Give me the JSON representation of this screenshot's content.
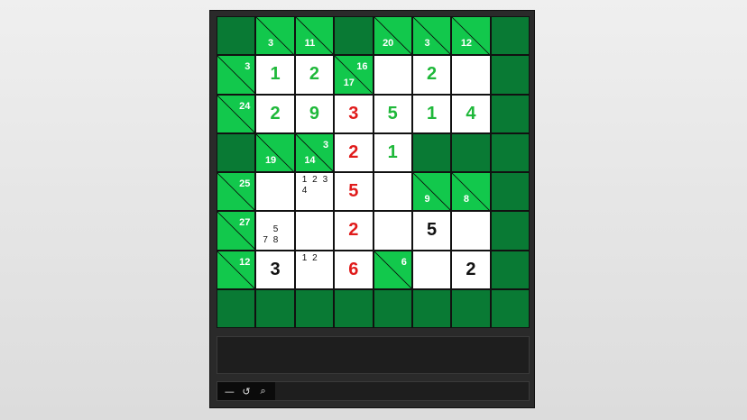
{
  "colors": {
    "clue": "#12c84c",
    "block": "#097a34",
    "given": "#1fb83a",
    "error": "#e01b1b",
    "entry": "#111111"
  },
  "rows": [
    [
      {
        "t": "block"
      },
      {
        "t": "clue",
        "down": "3"
      },
      {
        "t": "clue",
        "down": "11"
      },
      {
        "t": "block"
      },
      {
        "t": "clue",
        "down": "20"
      },
      {
        "t": "clue",
        "down": "3"
      },
      {
        "t": "clue",
        "down": "12"
      },
      {
        "t": "block"
      }
    ],
    [
      {
        "t": "clue",
        "across": "3"
      },
      {
        "t": "white",
        "v": "1",
        "s": "given"
      },
      {
        "t": "white",
        "v": "2",
        "s": "given"
      },
      {
        "t": "clue",
        "down": "17",
        "across": "16"
      },
      {
        "t": "white"
      },
      {
        "t": "white",
        "v": "2",
        "s": "given"
      },
      {
        "t": "white"
      },
      {
        "t": "block"
      }
    ],
    [
      {
        "t": "clue",
        "across": "24"
      },
      {
        "t": "white",
        "v": "2",
        "s": "given"
      },
      {
        "t": "white",
        "v": "9",
        "s": "given"
      },
      {
        "t": "white",
        "v": "3",
        "s": "error"
      },
      {
        "t": "white",
        "v": "5",
        "s": "given"
      },
      {
        "t": "white",
        "v": "1",
        "s": "given"
      },
      {
        "t": "white",
        "v": "4",
        "s": "given"
      },
      {
        "t": "block"
      }
    ],
    [
      {
        "t": "block"
      },
      {
        "t": "clue",
        "down": "19"
      },
      {
        "t": "clue",
        "down": "14",
        "across": "3"
      },
      {
        "t": "white",
        "v": "2",
        "s": "error"
      },
      {
        "t": "white",
        "v": "1",
        "s": "given"
      },
      {
        "t": "block"
      },
      {
        "t": "block"
      },
      {
        "t": "block"
      }
    ],
    [
      {
        "t": "clue",
        "across": "25"
      },
      {
        "t": "white"
      },
      {
        "t": "white",
        "notes": [
          "1",
          "2",
          "3",
          "4",
          "",
          "",
          "",
          "",
          ""
        ]
      },
      {
        "t": "white",
        "v": "5",
        "s": "error"
      },
      {
        "t": "white"
      },
      {
        "t": "clue",
        "down": "9"
      },
      {
        "t": "clue",
        "down": "8"
      },
      {
        "t": "block"
      }
    ],
    [
      {
        "t": "clue",
        "across": "27"
      },
      {
        "t": "white",
        "notes": [
          "",
          "",
          "",
          "",
          "5",
          "",
          "7",
          "8",
          ""
        ]
      },
      {
        "t": "white"
      },
      {
        "t": "white",
        "v": "2",
        "s": "error"
      },
      {
        "t": "white"
      },
      {
        "t": "white",
        "v": "5",
        "s": "entry"
      },
      {
        "t": "white"
      },
      {
        "t": "block"
      }
    ],
    [
      {
        "t": "clue",
        "across": "12"
      },
      {
        "t": "white",
        "v": "3",
        "s": "entry"
      },
      {
        "t": "white",
        "notes": [
          "1",
          "2",
          "",
          "",
          "",
          "",
          "",
          "",
          ""
        ]
      },
      {
        "t": "white",
        "v": "6",
        "s": "error"
      },
      {
        "t": "clue",
        "across": "6"
      },
      {
        "t": "white"
      },
      {
        "t": "white",
        "v": "2",
        "s": "entry"
      },
      {
        "t": "block"
      }
    ],
    [
      {
        "t": "block"
      },
      {
        "t": "block"
      },
      {
        "t": "block"
      },
      {
        "t": "block"
      },
      {
        "t": "block"
      },
      {
        "t": "block"
      },
      {
        "t": "block"
      },
      {
        "t": "block"
      }
    ]
  ],
  "toolbar": {
    "tools": [
      {
        "name": "minus-icon",
        "glyph": "—"
      },
      {
        "name": "undo-icon",
        "glyph": "↺"
      },
      {
        "name": "search-icon",
        "glyph": "⌕"
      }
    ]
  }
}
